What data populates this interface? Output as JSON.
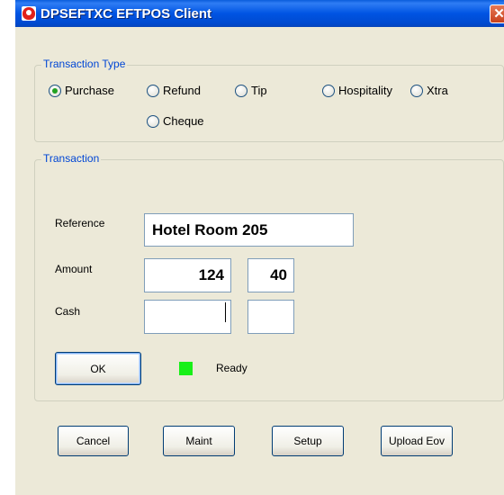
{
  "window": {
    "title": "DPSEFTXC EFTPOS Client",
    "close_symbol": "✕"
  },
  "transaction_type": {
    "legend": "Transaction Type",
    "options": [
      {
        "label": "Purchase",
        "selected": true
      },
      {
        "label": "Refund",
        "selected": false
      },
      {
        "label": "Tip",
        "selected": false
      },
      {
        "label": "Hospitality",
        "selected": false
      },
      {
        "label": "Xtra",
        "selected": false
      },
      {
        "label": "Cheque",
        "selected": false
      }
    ]
  },
  "transaction": {
    "legend": "Transaction",
    "reference_label": "Reference",
    "reference_value": "Hotel Room 205",
    "amount_label": "Amount",
    "amount_dollars": "124",
    "amount_cents": "40",
    "cash_label": "Cash",
    "cash_dollars": "",
    "cash_cents": "",
    "ok_label": "OK",
    "status_text": "Ready",
    "status_color": "#18f018"
  },
  "buttons": {
    "cancel": "Cancel",
    "maint": "Maint",
    "setup": "Setup",
    "upload": "Upload Eov"
  },
  "icons": {
    "app_icon": "red-circle-app-icon",
    "close": "close-icon"
  }
}
